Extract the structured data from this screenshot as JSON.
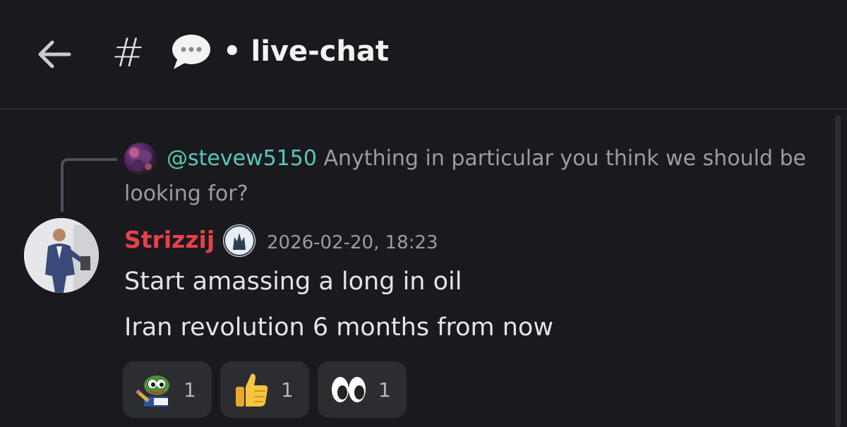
{
  "header": {
    "back_icon": "arrow-left-icon",
    "channel_prefix": "#",
    "channel_emoji": "speech-bubble-icon",
    "channel_name": "• live-chat"
  },
  "reply": {
    "mention": "@stevew5150",
    "text": "Anything in particular you think we should be looking for?"
  },
  "message": {
    "username": "Strizzij",
    "username_color": "#e5414a",
    "timestamp": "2026-02-20, 18:23",
    "lines": [
      "Start amassing a long in oil",
      "Iran revolution 6 months from now"
    ]
  },
  "reactions": [
    {
      "emoji": "pepe-writing-icon",
      "count": "1"
    },
    {
      "emoji": "thumbs-up-icon",
      "count": "1"
    },
    {
      "emoji": "eyes-icon",
      "count": "1"
    }
  ]
}
